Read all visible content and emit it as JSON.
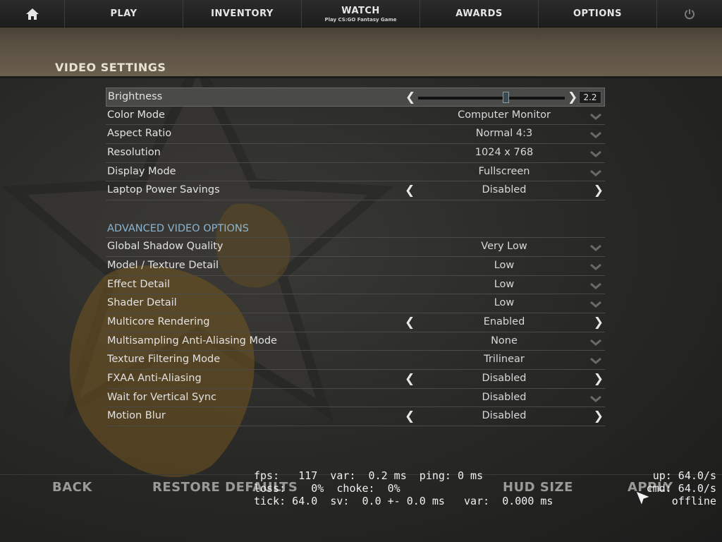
{
  "nav": {
    "play": "PLAY",
    "inventory": "INVENTORY",
    "watch": "WATCH",
    "watch_sub": "Play CS:GO Fantasy Game",
    "awards": "AWARDS",
    "options": "OPTIONS"
  },
  "page_title": "VIDEO SETTINGS",
  "basic": [
    {
      "label": "Brightness",
      "value": "2.2",
      "level": 0.6
    },
    {
      "label": "Color Mode",
      "value": "Computer Monitor"
    },
    {
      "label": "Aspect Ratio",
      "value": "Normal 4:3"
    },
    {
      "label": "Resolution",
      "value": "1024 x 768"
    },
    {
      "label": "Display Mode",
      "value": "Fullscreen"
    },
    {
      "label": "Laptop Power Savings",
      "value": "Disabled"
    }
  ],
  "advanced_title": "ADVANCED VIDEO OPTIONS",
  "advanced": [
    {
      "label": "Global Shadow Quality",
      "value": "Very Low"
    },
    {
      "label": "Model / Texture Detail",
      "value": "Low"
    },
    {
      "label": "Effect Detail",
      "value": "Low"
    },
    {
      "label": "Shader Detail",
      "value": "Low"
    },
    {
      "label": "Multicore Rendering",
      "value": "Enabled"
    },
    {
      "label": "Multisampling Anti-Aliasing Mode",
      "value": "None"
    },
    {
      "label": "Texture Filtering Mode",
      "value": "Trilinear"
    },
    {
      "label": "FXAA Anti-Aliasing",
      "value": "Disabled"
    },
    {
      "label": "Wait for Vertical Sync",
      "value": "Disabled"
    },
    {
      "label": "Motion Blur",
      "value": "Disabled"
    }
  ],
  "bottom": {
    "back": "BACK",
    "restore": "RESTORE DEFAULTS",
    "hud": "HUD SIZE",
    "apply": "APPLY"
  },
  "netgraph": {
    "line1": "fps:   117  var:  0.2 ms  ping: 0 ms",
    "line2": "loss:    0%  choke:  0%",
    "line3": "tick: 64.0  sv:  0.0 +- 0.0 ms   var:  0.000 ms",
    "up": "up: 64.0/s",
    "cmd": "cmd: 64.0/s",
    "status": "offline"
  },
  "colors": {
    "accent_section": "#8ab4d0",
    "band": "#5c5244"
  },
  "icons": {
    "home": "home-icon",
    "power": "power-icon",
    "cursor": "cursor-icon"
  }
}
